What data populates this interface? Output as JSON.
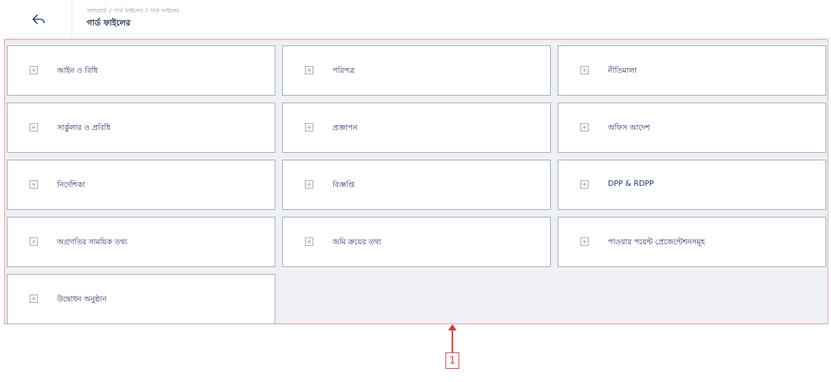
{
  "header": {
    "back_icon": "back-arrow-icon",
    "breadcrumb": [
      "ডাশবোর্ড",
      "গার্ড ফাইলের",
      "গার্ড ফাইলের"
    ],
    "breadcrumb_separator": "/",
    "title": "গার্ড ফাইলের"
  },
  "cards": [
    {
      "label": "আইন ও বিধি",
      "icon": "plus-square-icon"
    },
    {
      "label": "পরিপত্র",
      "icon": "plus-square-icon"
    },
    {
      "label": "নীতিমালা",
      "icon": "plus-square-icon"
    },
    {
      "label": "সার্কুলার ও প্রবিধি",
      "icon": "plus-square-icon"
    },
    {
      "label": "প্রজ্ঞাপন",
      "icon": "plus-square-icon"
    },
    {
      "label": "অফিস আদেশ",
      "icon": "plus-square-icon"
    },
    {
      "label": "নির্দেশিকা",
      "icon": "plus-square-icon"
    },
    {
      "label": "বিজ্ঞপ্তি",
      "icon": "plus-square-icon"
    },
    {
      "label": "DPP & RDPP",
      "icon": "plus-square-icon"
    },
    {
      "label": "অগ্রগতির সাময়িক তথ্য",
      "icon": "plus-square-icon"
    },
    {
      "label": "জমি ক্রয়ের তথ্য",
      "icon": "plus-square-icon"
    },
    {
      "label": "পাওয়ার পয়েন্ট প্রেজেন্টেশনসমূহ",
      "icon": "plus-square-icon"
    },
    {
      "label": "উদ্বোধন অনুষ্ঠান",
      "icon": "plus-square-icon"
    }
  ],
  "annotation": {
    "number": "1",
    "color": "#d63a3a"
  }
}
